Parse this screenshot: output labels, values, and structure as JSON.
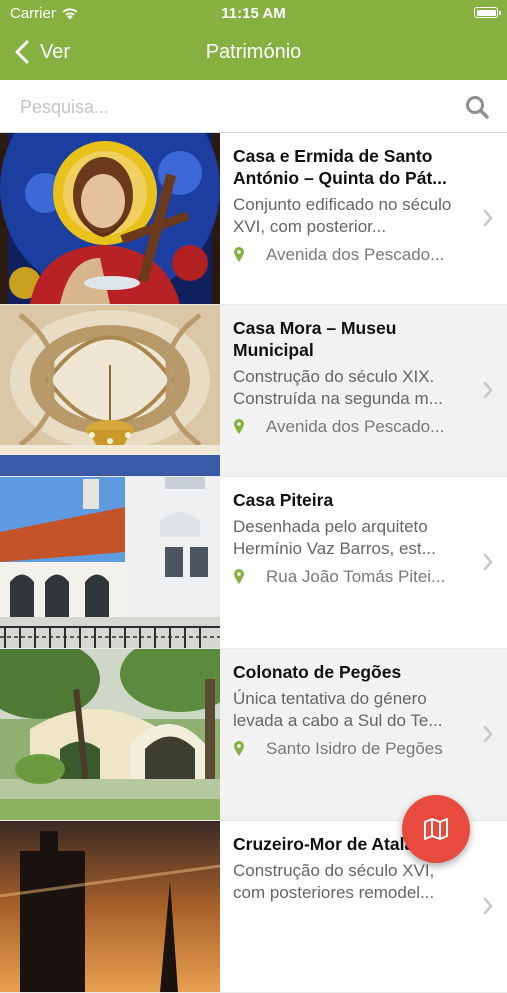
{
  "status_bar": {
    "carrier": "Carrier",
    "time": "11:15 AM"
  },
  "navbar": {
    "back_label": "Ver",
    "title": "Património"
  },
  "search": {
    "placeholder": "Pesquisa..."
  },
  "colors": {
    "brand_green": "#86b140",
    "fab_red": "#e84a3e",
    "pin_green": "#86b140"
  },
  "icons": {
    "back": "chevron-left-icon",
    "search": "magnifier-icon",
    "location": "map-pin-icon",
    "disclosure": "chevron-right-icon",
    "fab": "map-icon"
  },
  "items": [
    {
      "name": "Casa e Ermida de Santo António – Quinta do Pát...",
      "description": "Conjunto edificado no século XVI, com posterior...",
      "location": "Avenida dos Pescado..."
    },
    {
      "name": "Casa Mora – Museu Municipal",
      "description": "Construção do século XIX. Construída na segunda m...",
      "location": "Avenida dos Pescado..."
    },
    {
      "name": "Casa Piteira",
      "description": "Desenhada pelo arquiteto Hermínio Vaz Barros, est...",
      "location": "Rua João Tomás Pitei..."
    },
    {
      "name": "Colonato de Pegões",
      "description": "Única tentativa do género levada a cabo a Sul do Te...",
      "location": "Santo Isidro de Pegões"
    },
    {
      "name": "Cruzeiro-Mor de Atalaia",
      "description": "Construção do século XVI, com posteriores remodel...",
      "location": ""
    }
  ]
}
